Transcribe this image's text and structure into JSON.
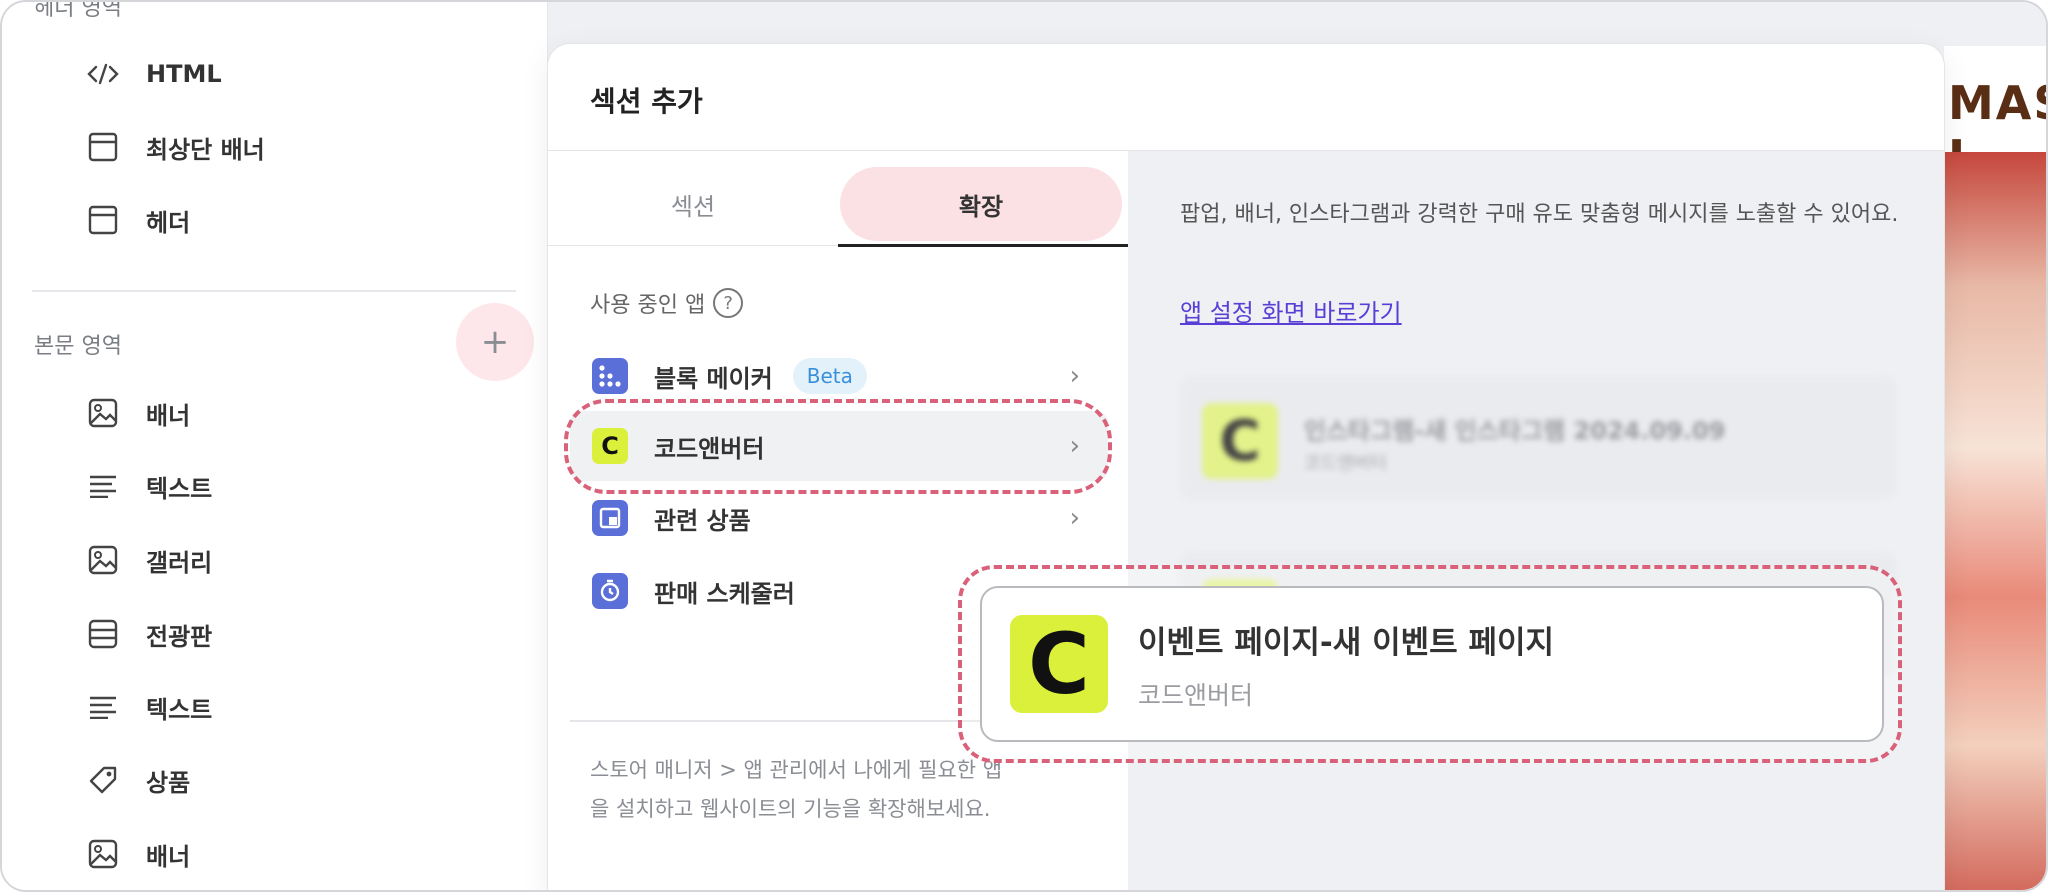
{
  "sidebar": {
    "header_section_label": "헤더 영역",
    "header_items": [
      {
        "label": "HTML",
        "icon": "code-icon"
      },
      {
        "label": "최상단 배너",
        "icon": "layout-icon"
      },
      {
        "label": "헤더",
        "icon": "layout-icon"
      }
    ],
    "body_section_label": "본문 영역",
    "add_symbol": "+",
    "body_items": [
      {
        "label": "배너",
        "icon": "image-icon"
      },
      {
        "label": "텍스트",
        "icon": "text-icon"
      },
      {
        "label": "갤러리",
        "icon": "image-icon"
      },
      {
        "label": "전광판",
        "icon": "board-icon"
      },
      {
        "label": "텍스트",
        "icon": "text-icon"
      },
      {
        "label": "상품",
        "icon": "tag-icon"
      },
      {
        "label": "배너",
        "icon": "image-icon"
      }
    ]
  },
  "preview": {
    "banner_text": "MAS I"
  },
  "modal": {
    "title": "섹션 추가",
    "tabs": [
      {
        "label": "섹션",
        "active": false
      },
      {
        "label": "확장",
        "active": true
      }
    ],
    "used_apps_label": "사용 중인 앱",
    "help_symbol": "?",
    "apps": [
      {
        "name": "블록 메이커",
        "badge": "Beta",
        "icon": "block-maker-icon",
        "color": "#5a6fd8",
        "chevron": "›"
      },
      {
        "name": "코드앤버터",
        "badge": "",
        "icon": "codenbutter-icon",
        "color": "#dbf03a",
        "glyph": "C",
        "chevron": "›"
      },
      {
        "name": "관련 상품",
        "badge": "",
        "icon": "related-products-icon",
        "color": "#5a6fd8",
        "chevron": "›"
      },
      {
        "name": "판매 스케줄러",
        "badge": "",
        "icon": "scheduler-icon",
        "color": "#5a6fd8",
        "chevron": ""
      }
    ],
    "footer_text": "스토어 매니저 > 앱 관리에서 나에게 필요한 앱을 설치하고 웹사이트의 기능을 확장해보세요.",
    "description": "팝업, 배너, 인스타그램과 강력한 구매 유도 맞춤형 메시지를 노출할 수 있어요.",
    "shortcut_link": "앱 설정 화면 바로가기",
    "blurred_cards": [
      {
        "title": "인스타그램-새 인스타그램 2024.09.09",
        "subtitle": "코드앤버터",
        "glyph": "C"
      },
      {
        "title": "",
        "subtitle": "",
        "glyph": "C"
      }
    ]
  },
  "callout": {
    "icon_glyph": "C",
    "title": "이벤트 페이지-새 이벤트 페이지",
    "subtitle": "코드앤버터",
    "highlight_color": "#d9617a"
  }
}
